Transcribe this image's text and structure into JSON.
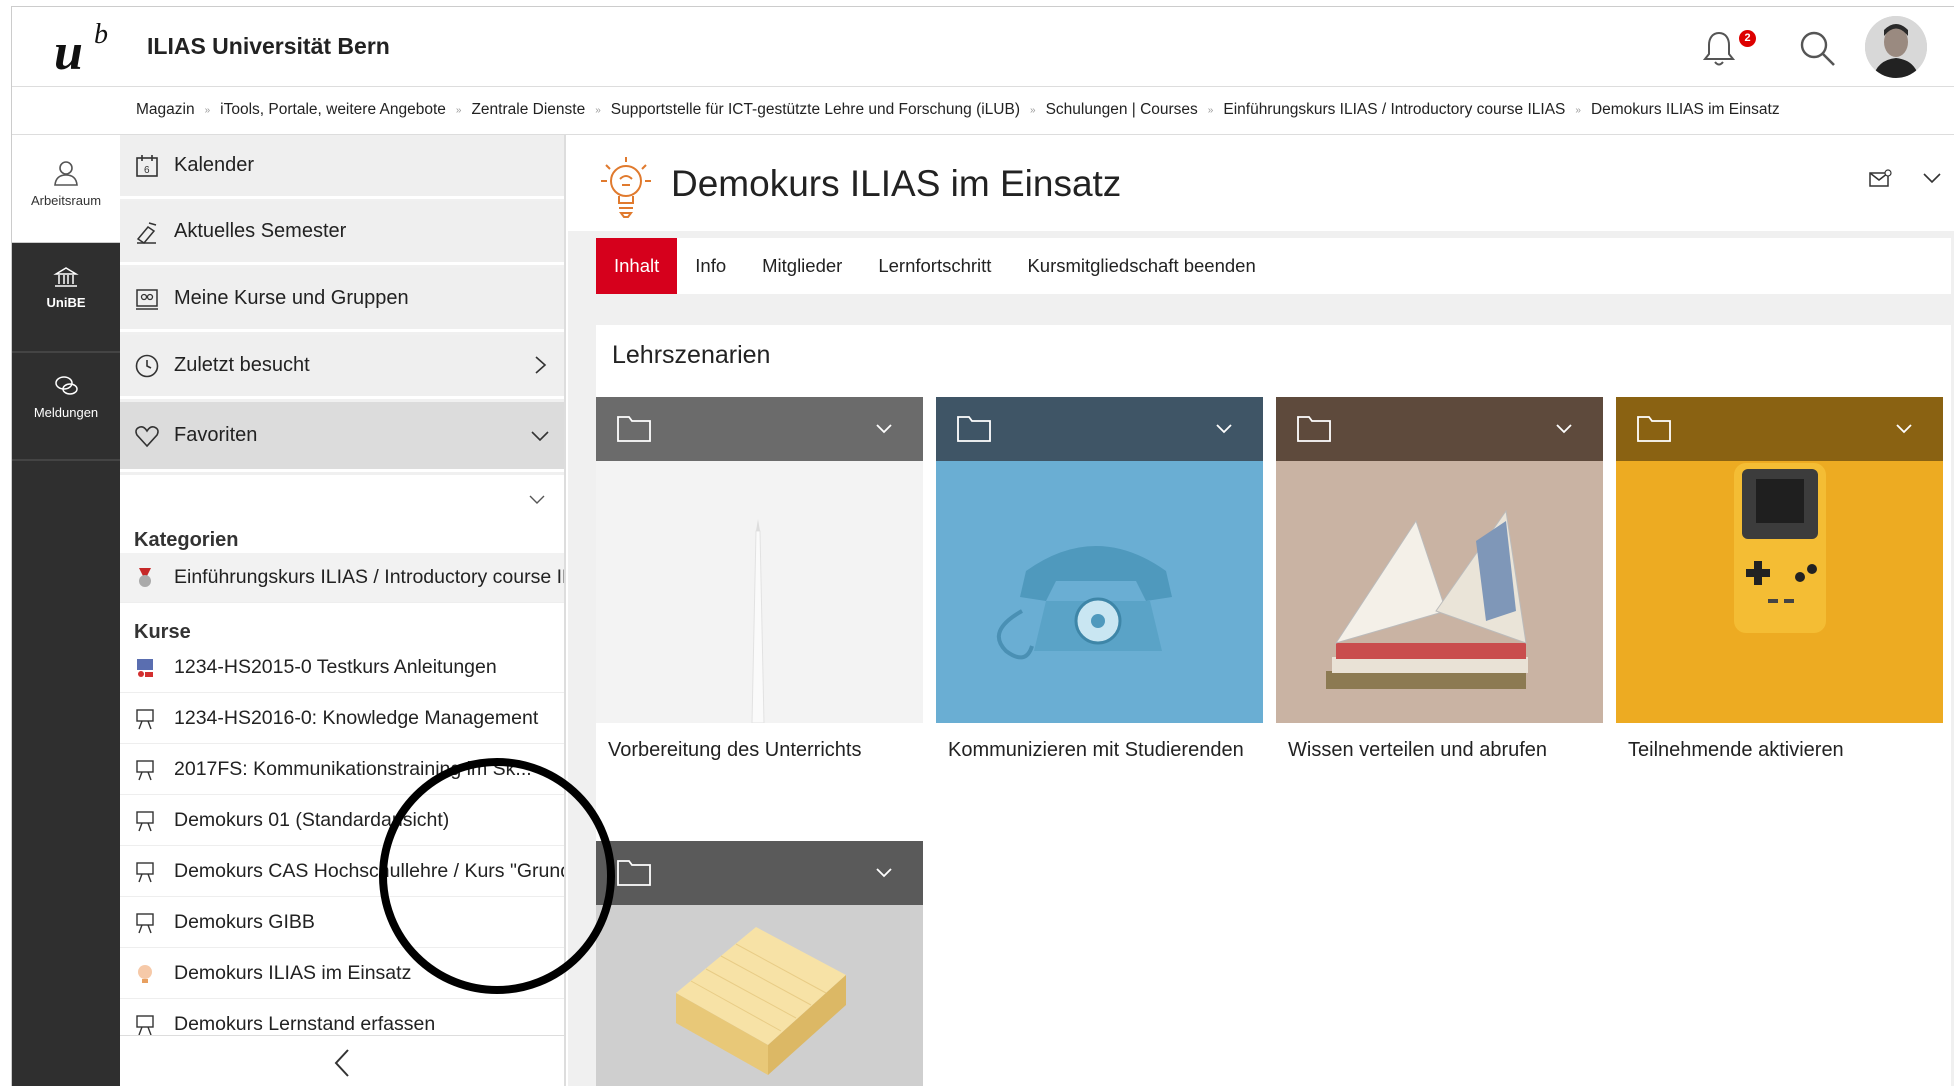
{
  "header": {
    "logo_letter": "u",
    "logo_sup": "b",
    "institution": "ILIAS Universität Bern",
    "notification_count": "2",
    "icons": [
      "bell-icon",
      "search-icon",
      "avatar"
    ]
  },
  "breadcrumbs": [
    "Magazin",
    "iTools, Portale, weitere Angebote",
    "Zentrale Dienste",
    "Supportstelle für ICT-gestützte Lehre und Forschung (iLUB)",
    "Schulungen | Courses",
    "Einführungskurs ILIAS / Introductory course ILIAS",
    "Demokurs ILIAS im Einsatz"
  ],
  "mainbar": {
    "items": [
      {
        "label": "Arbeitsraum",
        "icon": "user-icon"
      },
      {
        "label": "UniBE",
        "icon": "building-icon"
      },
      {
        "label": "Meldungen",
        "icon": "chat-icon"
      }
    ]
  },
  "slate": {
    "entries": [
      {
        "label": "Kalender",
        "icon": "calendar-icon"
      },
      {
        "label": "Aktuelles Semester",
        "icon": "semester-icon"
      },
      {
        "label": "Meine Kurse und Gruppen",
        "icon": "courses-icon"
      },
      {
        "label": "Zuletzt besucht",
        "icon": "clock-icon"
      },
      {
        "label": "Favoriten",
        "icon": "heart-icon"
      }
    ],
    "categories_heading": "Kategorien",
    "categories": [
      "Einführungskurs ILIAS / Introductory course ILIAS"
    ],
    "courses_heading": "Kurse",
    "courses": [
      "1234-HS2015-0 Testkurs Anleitungen",
      "1234-HS2016-0: Knowledge Management",
      "2017FS: Kommunikationstraining im Sk...",
      "Demokurs 01 (Standardansicht)",
      "Demokurs CAS Hochschullehre / Kurs \"Grundlagen\"",
      "Demokurs GIBB",
      "Demokurs ILIAS im Einsatz",
      "Demokurs Lernstand erfassen"
    ]
  },
  "content": {
    "title": "Demokurs ILIAS im Einsatz",
    "tabs": [
      "Inhalt",
      "Info",
      "Mitglieder",
      "Lernfortschritt",
      "Kursmitgliedschaft beenden"
    ],
    "active_tab": "Inhalt",
    "section_heading": "Lehrszenarien",
    "tiles": [
      {
        "caption": "Vorbereitung des Unterrichts",
        "header_color": "#6b6b6b",
        "image": "pen-image"
      },
      {
        "caption": "Kommunizieren mit Studierenden",
        "header_color": "#3f5566",
        "image": "telephone-image"
      },
      {
        "caption": "Wissen verteilen und abrufen",
        "header_color": "#5e4a3c",
        "image": "book-image"
      },
      {
        "caption": "Teilnehmende aktivieren",
        "header_color": "#8a6212",
        "image": "gameboy-image"
      },
      {
        "caption": "",
        "header_color": "#5a5a5a",
        "image": "notepad-image"
      }
    ]
  },
  "colors": {
    "accent": "#d6001c",
    "mainbar": "#2f2f2f",
    "slate_bg": "#f0f0f0"
  }
}
